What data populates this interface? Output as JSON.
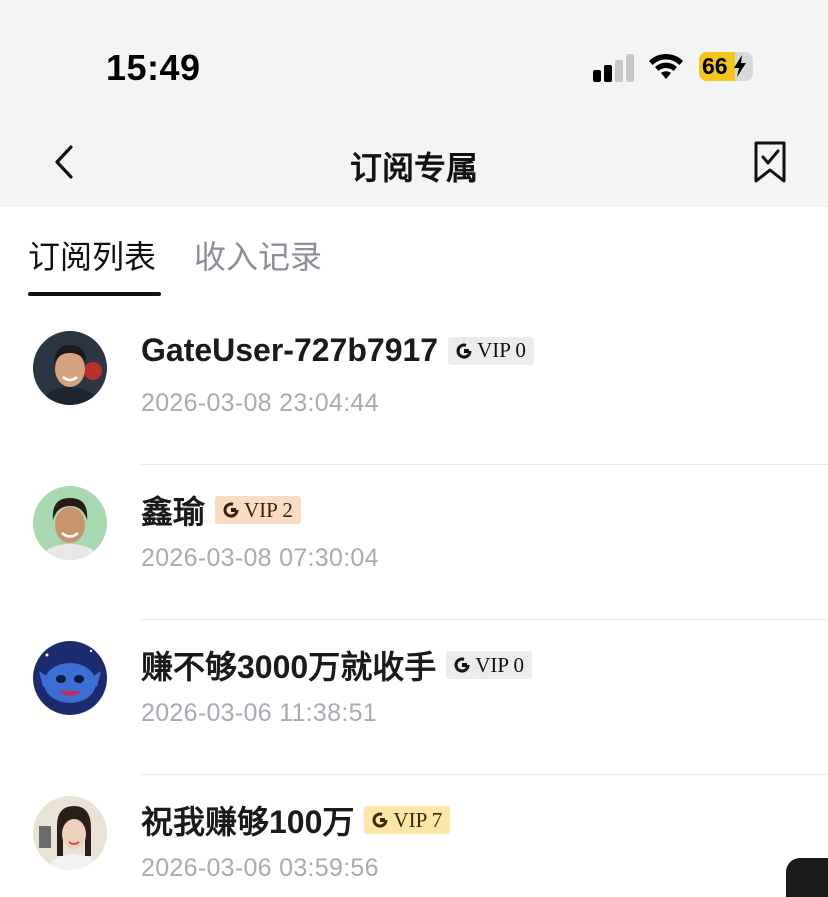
{
  "status_bar": {
    "time": "15:49",
    "battery_level": "66",
    "battery_fraction": 0.66
  },
  "header": {
    "title": "订阅专属",
    "back_icon": "chevron-left-icon",
    "bookmark_icon": "bookmark-icon"
  },
  "tabs": [
    {
      "label": "订阅列表",
      "active": true
    },
    {
      "label": "收入记录",
      "active": false
    }
  ],
  "subscribers": [
    {
      "name": "GateUser-727b7917",
      "vip": "VIP 0",
      "vip_color": "#ececec",
      "date": "2026-03-08 23:04:44"
    },
    {
      "name": "鑫瑜",
      "vip": "VIP 2",
      "vip_color": "#f8dcc4",
      "date": "2026-03-08 07:30:04"
    },
    {
      "name": "赚不够3000万就收手",
      "vip": "VIP 0",
      "vip_color": "#ececec",
      "date": "2026-03-06 11:38:51"
    },
    {
      "name": "祝我赚够100万",
      "vip": "VIP 7",
      "vip_color": "#fce7a6",
      "date": "2026-03-06 03:59:56"
    }
  ],
  "colors": {
    "header_bg": "#f3f4f6",
    "tab_inactive": "#8a8f98",
    "date_text": "#a7abb2",
    "battery_fill": "#f5c518"
  }
}
